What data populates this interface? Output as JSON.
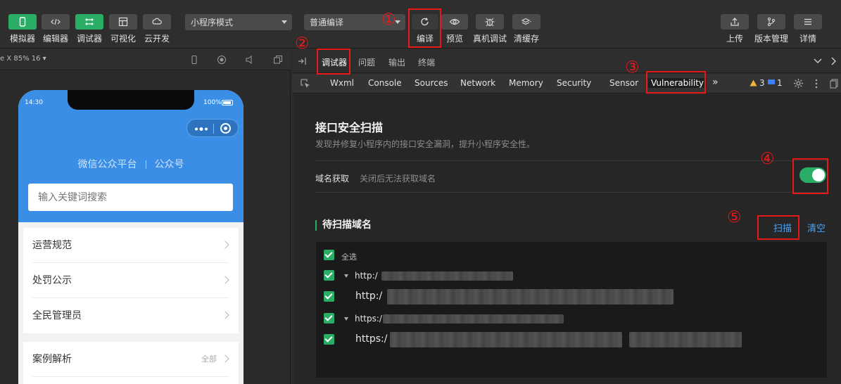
{
  "toolbar": {
    "left_buttons": [
      {
        "label": "模拟器",
        "icon": "phone-icon",
        "active": true
      },
      {
        "label": "编辑器",
        "icon": "code-icon",
        "active": false
      },
      {
        "label": "调试器",
        "icon": "debug-icon",
        "active": true
      },
      {
        "label": "可视化",
        "icon": "layout-icon",
        "active": false
      },
      {
        "label": "云开发",
        "icon": "cloud-icon",
        "active": false
      }
    ],
    "mode_select": "小程序模式",
    "compile_select": "普通编译",
    "center_buttons": [
      {
        "label": "编译",
        "icon": "refresh-icon"
      },
      {
        "label": "预览",
        "icon": "eye-icon"
      },
      {
        "label": "真机调试",
        "icon": "bug-icon"
      },
      {
        "label": "清缓存",
        "icon": "layers-icon"
      }
    ],
    "right_buttons": [
      {
        "label": "上传",
        "icon": "upload-icon"
      },
      {
        "label": "版本管理",
        "icon": "branch-icon"
      },
      {
        "label": "详情",
        "icon": "menu-icon"
      }
    ]
  },
  "simulator": {
    "device_info": "e X 85% 16 ▾",
    "status_time": "14:30",
    "battery": "100%",
    "links": [
      "微信公众平台",
      "公众号"
    ],
    "search_placeholder": "输入关键词搜索",
    "list": [
      "运营规范",
      "处罚公示",
      "全民管理员"
    ],
    "list2": {
      "label": "案例解析",
      "more": "全部"
    }
  },
  "devtools": {
    "top_tabs": [
      "调试器",
      "问题",
      "输出",
      "终端"
    ],
    "panel_tabs": [
      "Wxml",
      "Console",
      "Sources",
      "Network",
      "Memory",
      "Security",
      "Sensor",
      "Vulnerability"
    ],
    "warnings": "3",
    "messages": "1"
  },
  "scan": {
    "title": "接口安全扫描",
    "subtitle": "发现并修复小程序内的接口安全漏洞，提升小程序安全性。",
    "domain_fetch_label": "域名获取",
    "domain_fetch_desc": "关闭后无法获取域名",
    "domain_fetch_enabled": true,
    "pending_title": "待扫描域名",
    "scan_button": "扫描",
    "clear_button": "清空",
    "select_all": "全选",
    "domains": [
      "http:/",
      "http:/",
      "https:/",
      "https:/"
    ]
  },
  "annotations": [
    "①",
    "②",
    "③",
    "④",
    "⑤"
  ],
  "colors": {
    "accent_green": "#2aae67",
    "link_blue": "#4aa3f5",
    "annotation_red": "#e8191b",
    "phone_blue": "#3a8ee6"
  }
}
